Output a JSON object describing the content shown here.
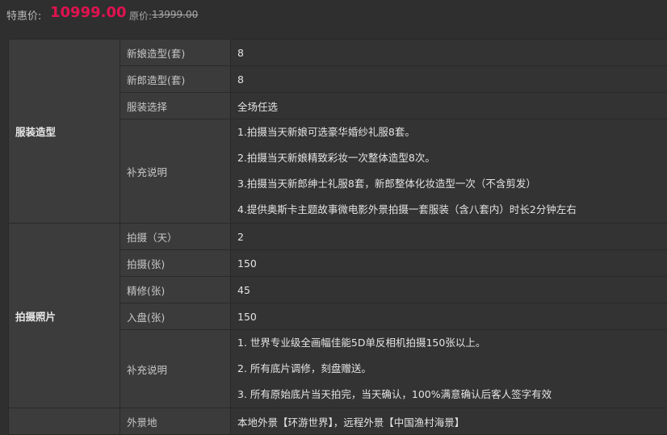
{
  "price": {
    "label": "特惠价:",
    "value": "10999.00",
    "original_label": "原价:",
    "original_value": "13999.00"
  },
  "sections": [
    {
      "title": "服装造型",
      "rows": [
        {
          "label": "新娘造型(套)",
          "value": "8"
        },
        {
          "label": "新郎造型(套)",
          "value": "8"
        },
        {
          "label": "服装选择",
          "value": "全场任选"
        }
      ],
      "notes_label": "补充说明",
      "notes": [
        "1.拍摄当天新娘可选豪华婚纱礼服8套。",
        "2.拍摄当天新娘精致彩妆一次整体造型8次。",
        "3.拍摄当天新郎绅士礼服8套，新郎整体化妆造型一次（不含剪发）",
        "4.提供奥斯卡主题故事微电影外景拍摄一套服装（含八套内）时长2分钟左右"
      ]
    },
    {
      "title": "拍摄照片",
      "rows": [
        {
          "label": "拍摄（天）",
          "value": "2"
        },
        {
          "label": "拍摄(张)",
          "value": "150"
        },
        {
          "label": "精修(张)",
          "value": "45"
        },
        {
          "label": "入盘(张)",
          "value": "150"
        }
      ],
      "notes_label": "补充说明",
      "notes": [
        "1. 世界专业级全画幅佳能5D单反相机拍摄150张以上。",
        "2. 所有底片调修，刻盘赠送。",
        "3. 所有原始底片当天拍完，当天确认，100%满意确认后客人签字有效"
      ]
    },
    {
      "title": "",
      "rows": [
        {
          "label": "外景地",
          "value": "本地外景【环游世界】，远程外景【中国渔村海景】"
        }
      ]
    }
  ]
}
